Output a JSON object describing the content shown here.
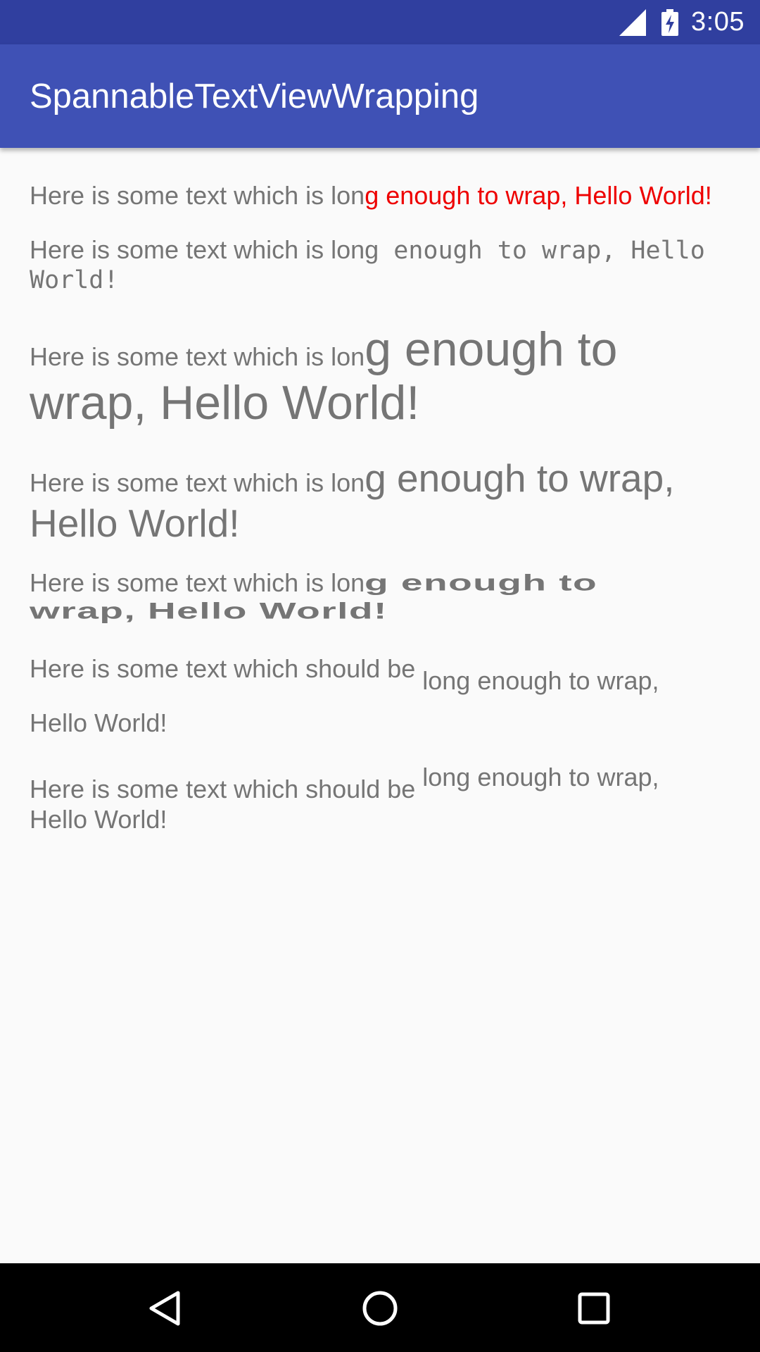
{
  "status_bar": {
    "time": "3:05",
    "icons": [
      "signal-icon",
      "battery-charging-icon"
    ]
  },
  "app_bar": {
    "title": "SpannableTextViewWrapping"
  },
  "samples": [
    {
      "name": "red-span",
      "prefix": "Here is some text which is lon",
      "span": "g enough to wrap, Hello World!",
      "color": "#ee0000"
    },
    {
      "name": "monospace-span",
      "prefix": "Here is some text which is long",
      "span_line1": " enough to wrap, Hello",
      "span_line2": "World!"
    },
    {
      "name": "large-size-span",
      "prefix": "Here is some text which is lon",
      "span_line1": "g enough to",
      "span_line2": "wrap, Hello World!"
    },
    {
      "name": "medium-size-span",
      "prefix": "Here is some text which is lon",
      "span_line1": "g enough to wrap,",
      "span_line2": "Hello World!"
    },
    {
      "name": "scale-x-span",
      "prefix": "Here is some text which is lon",
      "span_line1": "g enough to",
      "span_line2": "wrap, Hello World!"
    },
    {
      "name": "subscript-span",
      "prefix": "Here is some text which should be ",
      "span": "long enough to wrap,",
      "line2": "Hello World!"
    },
    {
      "name": "superscript-span",
      "prefix": "Here is some text which should be ",
      "span": "long enough to wrap,",
      "line2": "Hello World!"
    }
  ],
  "colors": {
    "status_bar": "#303f9f",
    "app_bar": "#3f51b5",
    "text": "#757575",
    "accent_red": "#ee0000",
    "background": "#fafafa",
    "nav_bar": "#000000"
  },
  "nav_bar": {
    "buttons": [
      "back-icon",
      "home-icon",
      "recent-apps-icon"
    ]
  }
}
